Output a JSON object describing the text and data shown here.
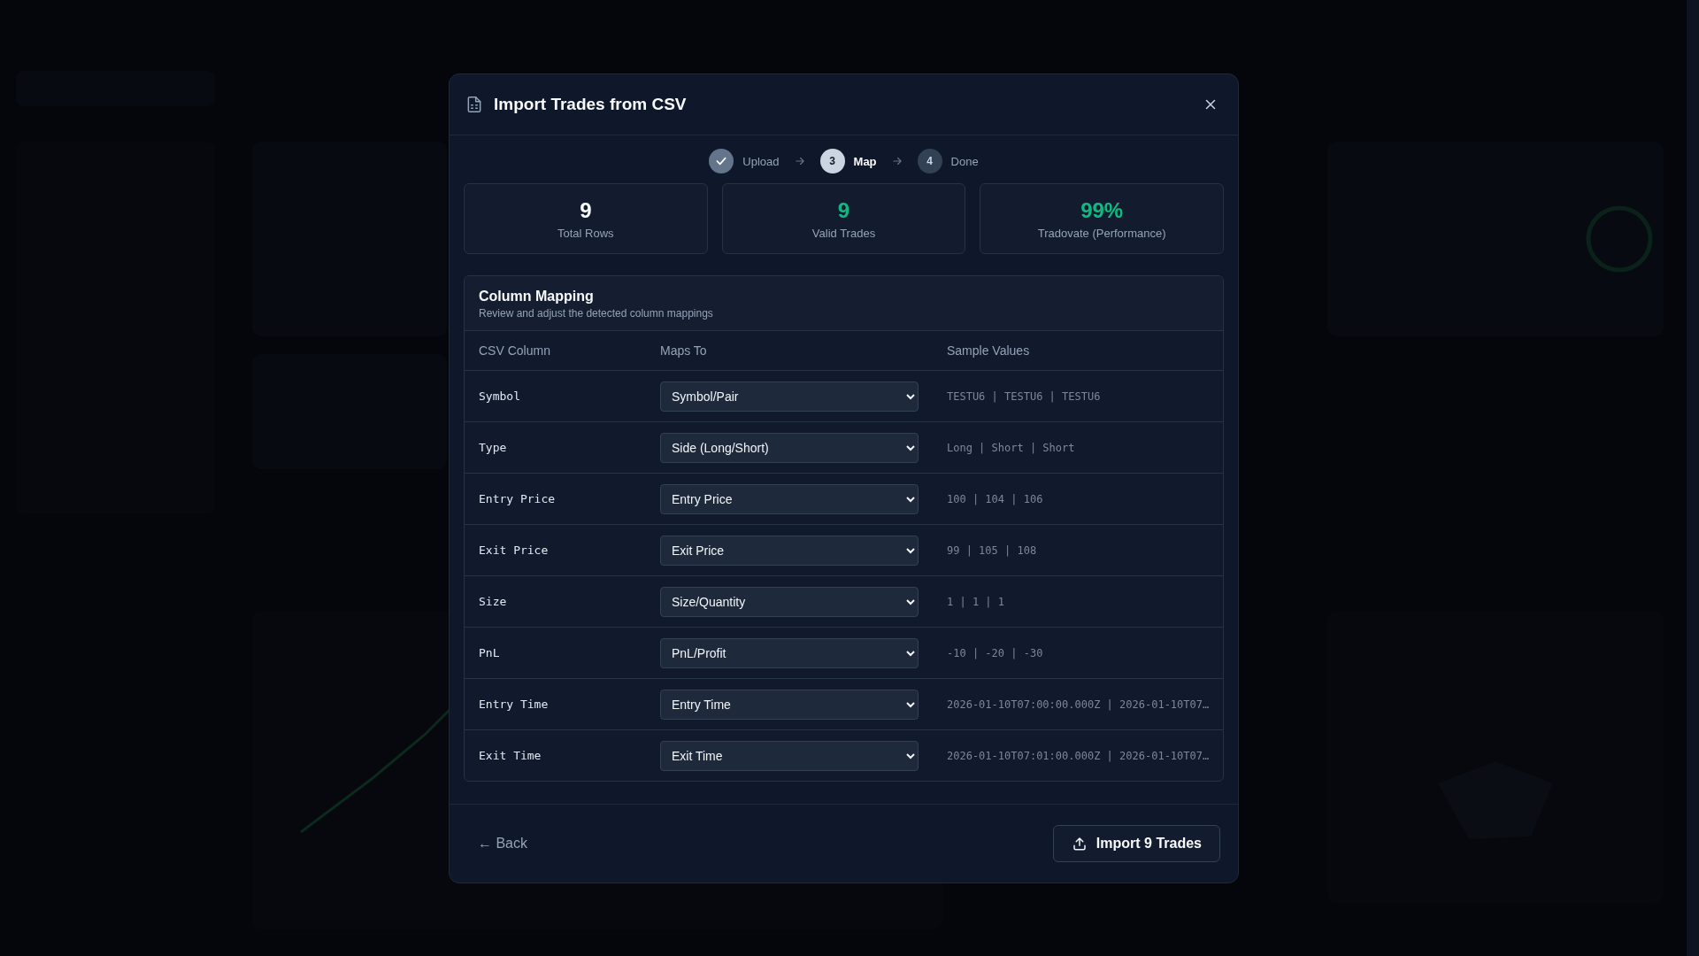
{
  "dialog": {
    "title": "Import Trades from CSV",
    "steps": [
      {
        "kind": "done",
        "label": "Upload"
      },
      {
        "kind": "current",
        "number": "3",
        "label": "Map"
      },
      {
        "kind": "pending",
        "number": "4",
        "label": "Done"
      }
    ],
    "stats": [
      {
        "value": "9",
        "label": "Total Rows",
        "color": "#f8fafc"
      },
      {
        "value": "9",
        "label": "Valid Trades",
        "color": "#10b981"
      },
      {
        "value": "99%",
        "label": "Tradovate (Performance)",
        "color": "#10b981"
      }
    ],
    "mapping": {
      "title": "Column Mapping",
      "subtitle": "Review and adjust the detected column mappings",
      "columns": [
        "CSV Column",
        "Maps To",
        "Sample Values"
      ],
      "rows": [
        {
          "csv_column": "Symbol",
          "maps_to": "Symbol/Pair",
          "samples": "TESTU6 | TESTU6 | TESTU6"
        },
        {
          "csv_column": "Type",
          "maps_to": "Side (Long/Short)",
          "samples": "Long | Short | Short"
        },
        {
          "csv_column": "Entry Price",
          "maps_to": "Entry Price",
          "samples": "100 | 104 | 106"
        },
        {
          "csv_column": "Exit Price",
          "maps_to": "Exit Price",
          "samples": "99 | 105 | 108"
        },
        {
          "csv_column": "Size",
          "maps_to": "Size/Quantity",
          "samples": "1 | 1 | 1"
        },
        {
          "csv_column": "PnL",
          "maps_to": "PnL/Profit",
          "samples": "-10 | -20 | -30"
        },
        {
          "csv_column": "Entry Time",
          "maps_to": "Entry Time",
          "samples": "2026-01-10T07:00:00.000Z | 2026-01-10T07…"
        },
        {
          "csv_column": "Exit Time",
          "maps_to": "Exit Time",
          "samples": "2026-01-10T07:01:00.000Z | 2026-01-10T07…"
        }
      ]
    },
    "back_button": "← Back",
    "import_button": "Import 9 Trades"
  }
}
